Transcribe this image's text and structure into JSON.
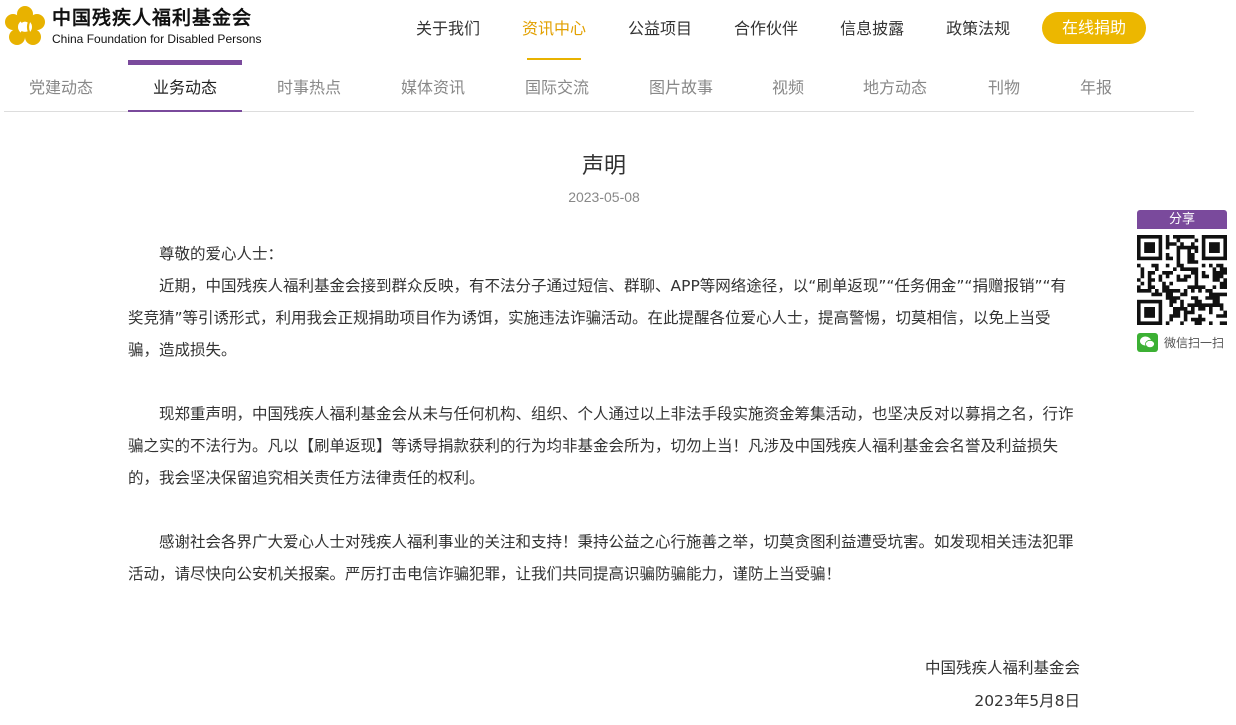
{
  "brand": {
    "name_cn": "中国残疾人福利基金会",
    "name_en": "China Foundation for Disabled Persons",
    "accent": "#e8b200",
    "purple": "#7a4a9c"
  },
  "nav": {
    "items": [
      "关于我们",
      "资讯中心",
      "公益项目",
      "合作伙伴",
      "信息披露",
      "政策法规"
    ],
    "active_index": 1,
    "donate_label": "在线捐助"
  },
  "subnav": {
    "items": [
      "党建动态",
      "业务动态",
      "时事热点",
      "媒体资讯",
      "国际交流",
      "图片故事",
      "视频",
      "地方动态",
      "刊物",
      "年报"
    ],
    "active_index": 1
  },
  "article": {
    "title": "声明",
    "date": "2023-05-08",
    "greeting": "尊敬的爱心人士：",
    "paragraphs": [
      "近期，中国残疾人福利基金会接到群众反映，有不法分子通过短信、群聊、APP等网络途径，以“刷单返现”“任务佣金”“捐赠报销”“有奖竞猜”等引诱形式，利用我会正规捐助项目作为诱饵，实施违法诈骗活动。在此提醒各位爱心人士，提高警惕，切莫相信，以免上当受骗，造成损失。",
      "现郑重声明，中国残疾人福利基金会从未与任何机构、组织、个人通过以上非法手段实施资金筹集活动，也坚决反对以募捐之名，行诈骗之实的不法行为。凡以【刷单返现】等诱导捐款获利的行为均非基金会所为，切勿上当！凡涉及中国残疾人福利基金会名誉及利益损失的，我会坚决保留追究相关责任方法律责任的权利。",
      "感谢社会各界广大爱心人士对残疾人福利事业的关注和支持！秉持公益之心行施善之举，切莫贪图利益遭受坑害。如发现相关违法犯罪活动，请尽快向公安机关报案。严厉打击电信诈骗犯罪，让我们共同提高识骗防骗能力，谨防上当受骗！"
    ],
    "signature_org": "中国残疾人福利基金会",
    "signature_date": "2023年5月8日"
  },
  "share": {
    "label": "分享",
    "wechat_text": "微信扫一扫",
    "qr_icon": "qr-code",
    "wechat_icon": "wechat-logo"
  }
}
